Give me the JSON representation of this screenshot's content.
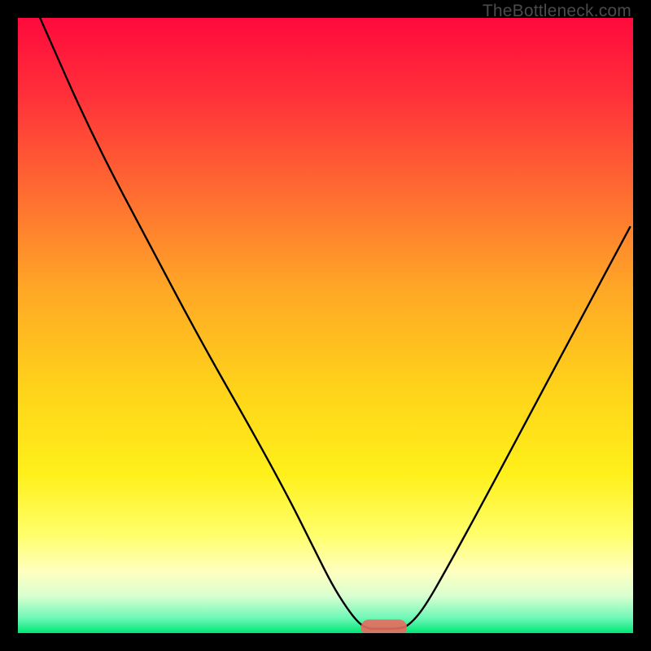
{
  "watermark": "TheBottleneck.com",
  "chart_data": {
    "type": "line",
    "title": "",
    "xlabel": "",
    "ylabel": "",
    "xlim": [
      0,
      100
    ],
    "ylim": [
      0,
      100
    ],
    "background_gradient_stops": [
      {
        "offset": 0.0,
        "color": "#ff0a3c"
      },
      {
        "offset": 0.12,
        "color": "#ff2e3a"
      },
      {
        "offset": 0.28,
        "color": "#ff6a32"
      },
      {
        "offset": 0.44,
        "color": "#ffa726"
      },
      {
        "offset": 0.6,
        "color": "#ffd21a"
      },
      {
        "offset": 0.74,
        "color": "#fff01a"
      },
      {
        "offset": 0.84,
        "color": "#ffff6a"
      },
      {
        "offset": 0.9,
        "color": "#ffffc0"
      },
      {
        "offset": 0.94,
        "color": "#d8ffd0"
      },
      {
        "offset": 0.975,
        "color": "#70f8b8"
      },
      {
        "offset": 1.0,
        "color": "#00e676"
      }
    ],
    "series": [
      {
        "name": "bottleneck-curve",
        "x": [
          3.6,
          12,
          22,
          30,
          38,
          44,
          48,
          51,
          53.5,
          55.5,
          57,
          58,
          62,
          63.5,
          66,
          70,
          76,
          84,
          92,
          99.5
        ],
        "y": [
          100,
          81,
          62,
          47,
          33,
          22,
          14,
          8,
          4,
          1.5,
          0.7,
          0.7,
          0.7,
          1.2,
          4,
          11,
          22,
          37,
          52,
          66
        ]
      }
    ],
    "marker": {
      "shape": "rounded-rect",
      "x_center": 59.5,
      "y_center": 0.9,
      "width": 7.5,
      "height": 2.6,
      "fill": "#e86a5e",
      "opacity": 0.9
    }
  }
}
